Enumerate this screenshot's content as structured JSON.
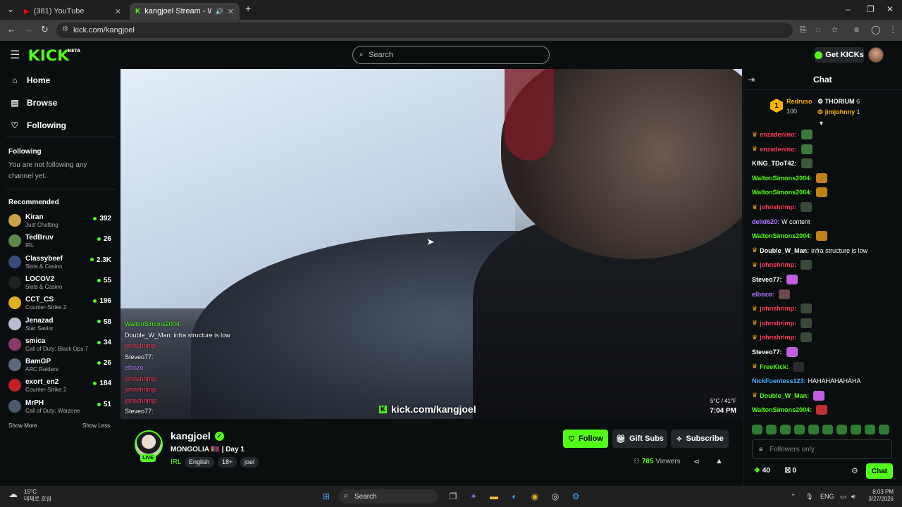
{
  "browser": {
    "tabs": [
      {
        "label": "(381) YouTube",
        "active": false
      },
      {
        "label": "kangjoel Stream - Watch Li",
        "active": true
      }
    ],
    "url": "kick.com/kangjoel"
  },
  "topnav": {
    "logo": "KICK",
    "logo_badge": "BETA",
    "search_placeholder": "Search",
    "get_kicks_label": "Get KICKs"
  },
  "sidebar": {
    "nav": [
      {
        "label": "Home",
        "icon": "home-icon"
      },
      {
        "label": "Browse",
        "icon": "browse-icon"
      },
      {
        "label": "Following",
        "icon": "heart-icon"
      }
    ],
    "following_title": "Following",
    "following_note": "You are not following any channel yet.",
    "recommended_title": "Recommended",
    "recommended": [
      {
        "name": "Kiran",
        "category": "Just Chatting",
        "viewers": "392",
        "color": "#c9a24a"
      },
      {
        "name": "TedBruv",
        "category": "IRL",
        "viewers": "26",
        "color": "#5c8a4a"
      },
      {
        "name": "Classybeef",
        "category": "Slots & Casino",
        "viewers": "2.3K",
        "color": "#3a4a7a"
      },
      {
        "name": "LOCOV2",
        "category": "Slots & Casino",
        "viewers": "55",
        "color": "#222222"
      },
      {
        "name": "CCT_CS",
        "category": "Counter-Strike 2",
        "viewers": "196",
        "color": "#e0b020"
      },
      {
        "name": "Jenazad",
        "category": "Star Savior",
        "viewers": "58",
        "color": "#bcbcd0"
      },
      {
        "name": "smica",
        "category": "Call of Duty: Black Ops 7",
        "viewers": "34",
        "color": "#8a3a6a"
      },
      {
        "name": "BamGP",
        "category": "ARC Raiders",
        "viewers": "26",
        "color": "#5a6a7a"
      },
      {
        "name": "exort_en2",
        "category": "Counter-Strike 2",
        "viewers": "184",
        "color": "#c02020"
      },
      {
        "name": "MrPH",
        "category": "Call of Duty: Warzone",
        "viewers": "51",
        "color": "#4a5a6a"
      }
    ],
    "show_more": "Show More",
    "show_less": "Show Less"
  },
  "player": {
    "overlay_chat": [
      {
        "user": "WaltonSimons2004:",
        "text": "",
        "color": "#53fc18"
      },
      {
        "user": "Double_W_Man:",
        "text": "infra structure is low",
        "color": "#ffffff"
      },
      {
        "user": "johnshrimp",
        "text": "",
        "color": "#ff3b5c"
      },
      {
        "user": "Steveo77:",
        "text": "",
        "color": "#ffffff"
      },
      {
        "user": "elbozo:",
        "text": "",
        "color": "#b07bff"
      },
      {
        "user": "johnshrimp:",
        "text": "",
        "color": "#ff3b5c"
      },
      {
        "user": "johnshrimp:",
        "text": "",
        "color": "#ff3b5c"
      },
      {
        "user": "johnshrimp:",
        "text": "",
        "color": "#ff3b5c"
      },
      {
        "user": "Steveo77:",
        "text": "",
        "color": "#ffffff"
      }
    ],
    "overlay_url": "kick.com/kangjoel",
    "temperature": "5°C / 41°F",
    "time": "7:04 PM"
  },
  "stream": {
    "streamer": "kangjoel",
    "live_label": "LIVE",
    "title": "MONGOLIA 🇲🇳 | Day 1",
    "category": "IRL",
    "tags": [
      "English",
      "18+",
      "joel"
    ],
    "follow_label": "Follow",
    "gift_subs_label": "Gift Subs",
    "subscribe_label": "Subscribe",
    "viewers_count": "785",
    "viewers_label": "Viewers"
  },
  "chat": {
    "title": "Chat",
    "leaderboard": {
      "rank": "1",
      "top_user": "Redruso",
      "top_count": "100",
      "entries": [
        {
          "user": "THORIUM",
          "count": "6"
        },
        {
          "user": "jimjohnny",
          "count": "1"
        }
      ]
    },
    "messages": [
      {
        "user": "enzadenino:",
        "text": "",
        "color": "#ff3b5c",
        "badge": "crown",
        "emote": "#3a7a3a"
      },
      {
        "user": "enzadenino:",
        "text": "",
        "color": "#ff3b5c",
        "badge": "crown",
        "emote": "#3a7a3a"
      },
      {
        "user": "KING_TDoT42:",
        "text": "",
        "color": "#ffffff",
        "badge": "",
        "emote": "#3a5a3a"
      },
      {
        "user": "WaltonSimons2004:",
        "text": "",
        "color": "#53fc18",
        "badge": "",
        "emote": "#c0801a"
      },
      {
        "user": "WaltonSimons2004:",
        "text": "",
        "color": "#53fc18",
        "badge": "",
        "emote": "#c0801a"
      },
      {
        "user": "johnshrimp:",
        "text": "",
        "color": "#ff3b5c",
        "badge": "crown",
        "emote": "#3a4a3a"
      },
      {
        "user": "delid620:",
        "text": "W content",
        "color": "#b07bff",
        "badge": "",
        "emote": ""
      },
      {
        "user": "WaltonSimons2004:",
        "text": "",
        "color": "#53fc18",
        "badge": "",
        "emote": "#c0801a"
      },
      {
        "user": "Double_W_Man:",
        "text": "infra structure is low",
        "color": "#ffffff",
        "badge": "crown",
        "emote": ""
      },
      {
        "user": "johnshrimp:",
        "text": "",
        "color": "#ff3b5c",
        "badge": "crown",
        "emote": "#3a4a3a"
      },
      {
        "user": "Steveo77:",
        "text": "",
        "color": "#ffffff",
        "badge": "",
        "emote": "#c060e0"
      },
      {
        "user": "elbozo:",
        "text": "",
        "color": "#b07bff",
        "badge": "",
        "emote": "#6a4a4a"
      },
      {
        "user": "johnshrimp:",
        "text": "",
        "color": "#ff3b5c",
        "badge": "crown",
        "emote": "#3a4a3a"
      },
      {
        "user": "johnshrimp:",
        "text": "",
        "color": "#ff3b5c",
        "badge": "crown",
        "emote": "#3a4a3a"
      },
      {
        "user": "johnshrimp:",
        "text": "",
        "color": "#ff3b5c",
        "badge": "crown",
        "emote": "#3a4a3a"
      },
      {
        "user": "Steveo77:",
        "text": "",
        "color": "#ffffff",
        "badge": "",
        "emote": "#c060e0"
      },
      {
        "user": "FreeKick:",
        "text": "",
        "color": "#53fc18",
        "badge": "crown",
        "emote": "#2a2a2a"
      },
      {
        "user": "NickFuentess123:",
        "text": "HAHAHAHAHAHA",
        "color": "#4aa8ff",
        "badge": "",
        "emote": ""
      },
      {
        "user": "Double_W_Man:",
        "text": "",
        "color": "#53fc18",
        "badge": "crown",
        "emote": "#c060e0"
      },
      {
        "user": "WaltonSimons2004:",
        "text": "",
        "color": "#53fc18",
        "badge": "",
        "emote": "#c03030"
      }
    ],
    "input_placeholder": "Followers only",
    "kicks_count": "40",
    "gift_count": "0",
    "chat_button": "Chat"
  },
  "taskbar": {
    "weather_temp": "15°C",
    "weather_desc": "대체로 흐림",
    "search_label": "Search",
    "lang": "ENG",
    "time": "8:03 PM",
    "date": "3/27/2026"
  },
  "colors": {
    "accent": "#53fc18",
    "background": "#0b0e0f"
  }
}
